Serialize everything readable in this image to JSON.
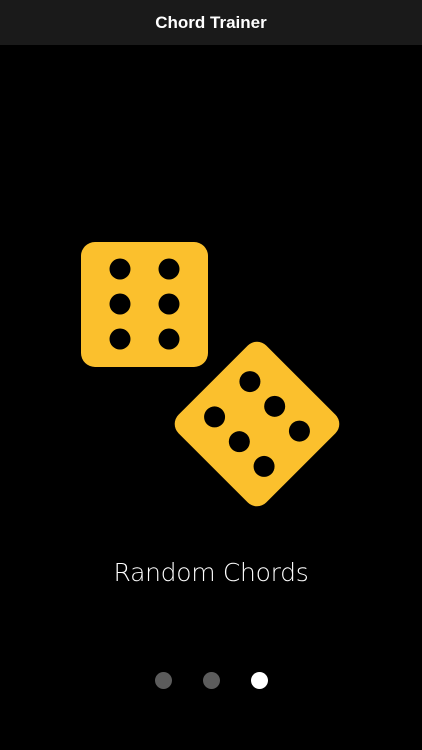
{
  "nav": {
    "title": "Chord Trainer"
  },
  "illustration": {
    "icon": "dice-icon",
    "color": "#fbc02d",
    "pip_color": "#000000"
  },
  "onboarding": {
    "caption": "Random Chords"
  },
  "pager": {
    "page_count": 3,
    "current_page": 3,
    "active_color": "#ffffff",
    "inactive_color": "#5c5c5c"
  }
}
